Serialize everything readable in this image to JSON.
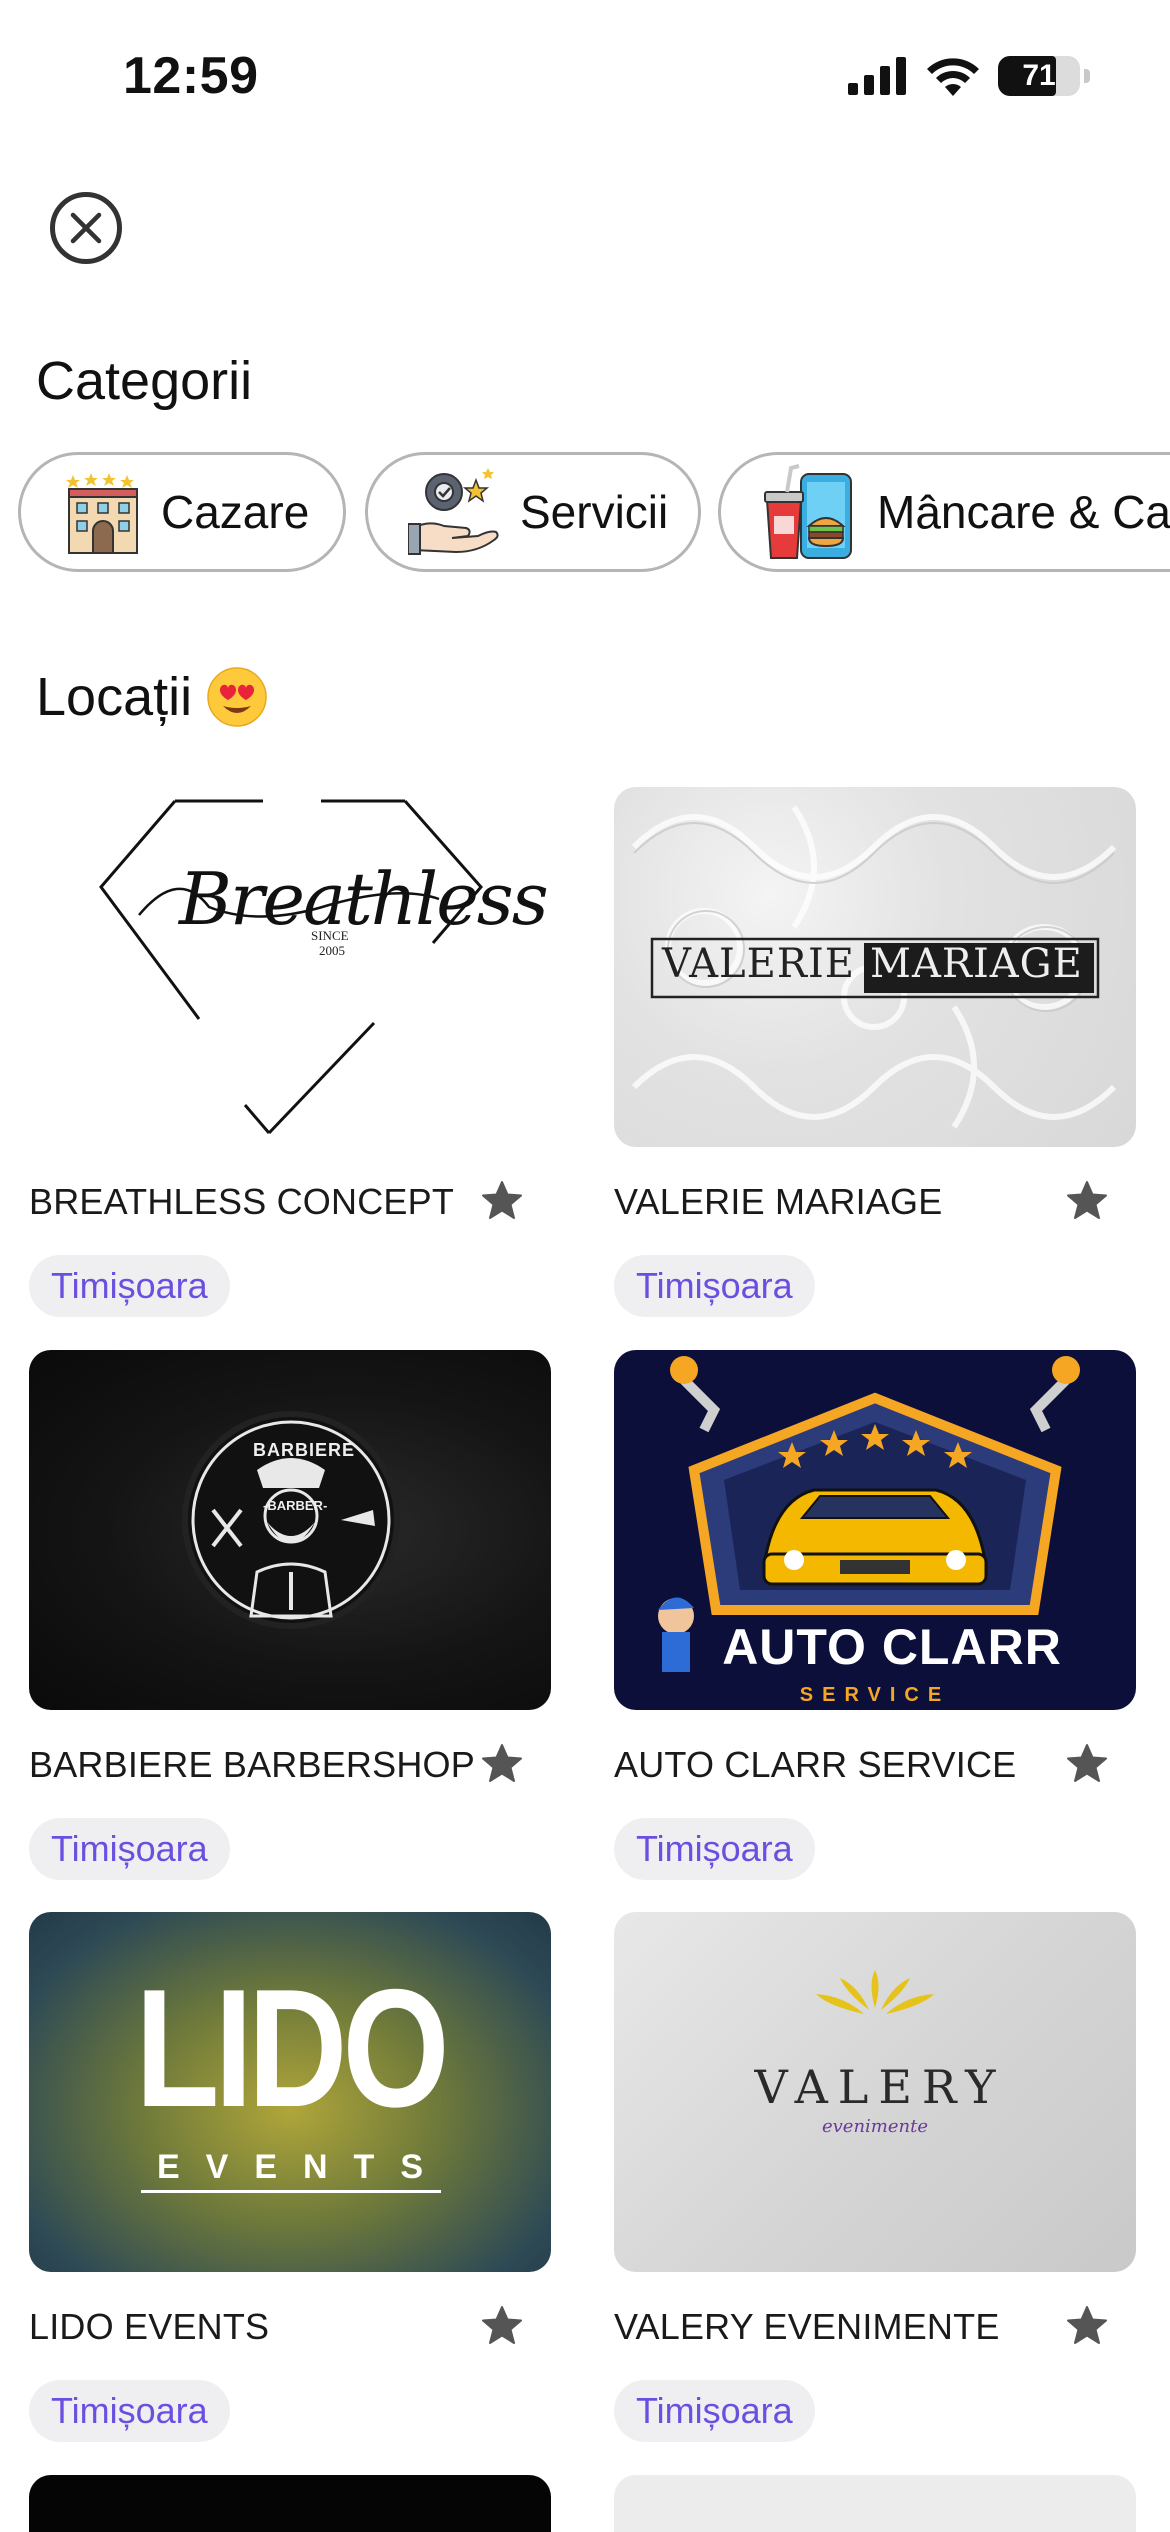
{
  "status": {
    "time": "12:59",
    "battery": "71"
  },
  "close_icon": "close-icon",
  "categories_title": "Categorii",
  "categories": [
    {
      "label": "Cazare",
      "icon": "hotel-icon"
    },
    {
      "label": "Servicii",
      "icon": "services-icon"
    },
    {
      "label": "Mâncare & Cafea",
      "icon": "food-drink-icon"
    }
  ],
  "locations_title": "Locații",
  "locations_emoji": "heart-eyes-emoji",
  "locations": [
    {
      "name": "BREATHLESS CONCEPT",
      "city": "Timișoara",
      "logo_text": "Breathless",
      "logo_sub1": "SINCE",
      "logo_sub2": "2005"
    },
    {
      "name": "VALERIE MARIAGE",
      "city": "Timișoara",
      "logo_left": "VALERIE",
      "logo_right": "MARIAGE"
    },
    {
      "name": "BARBIERE BARBERSHOP",
      "city": "Timișoara",
      "logo_top": "BARBIERE",
      "logo_mid": "-BARBER-"
    },
    {
      "name": "AUTO CLARR SERVICE",
      "city": "Timișoara",
      "logo_main": "AUTO CLARR",
      "logo_sub": "SERVICE"
    },
    {
      "name": "LIDO EVENTS",
      "city": "Timișoara",
      "logo_main": "LIDO",
      "logo_sub": "EVENTS"
    },
    {
      "name": "VALERY EVENIMENTE",
      "city": "Timișoara",
      "logo_main": "VALERY",
      "logo_sub": "evenimente"
    }
  ],
  "colors": {
    "accent": "#6b4fe0",
    "chip_border": "#b5b5b5",
    "city_bg": "#efeff1"
  }
}
